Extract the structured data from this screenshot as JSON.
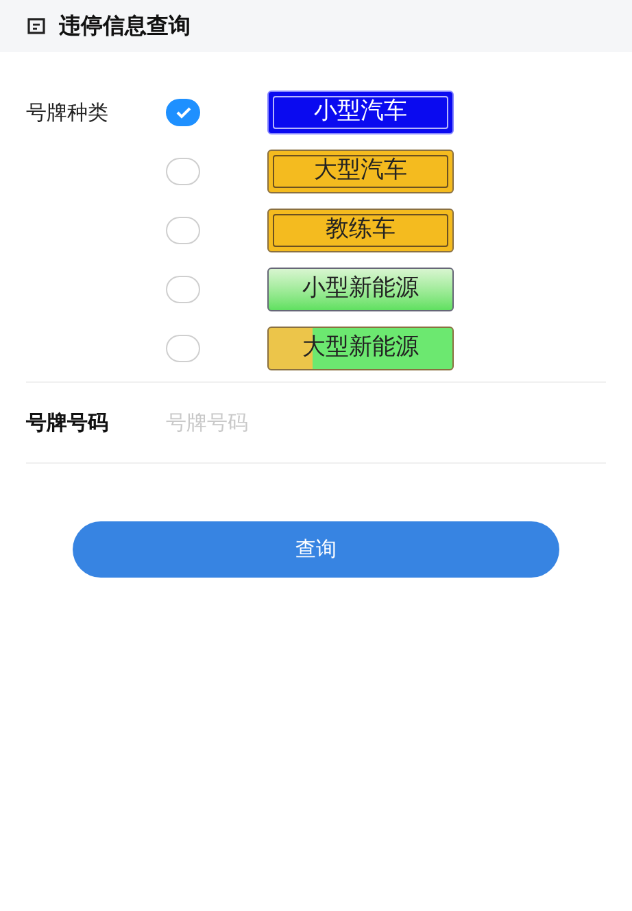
{
  "header": {
    "title": "违停信息查询"
  },
  "plate_type": {
    "label": "号牌种类",
    "options": [
      {
        "text": "小型汽车",
        "kind": "blue",
        "selected": true
      },
      {
        "text": "大型汽车",
        "kind": "yellow",
        "selected": false
      },
      {
        "text": "教练车",
        "kind": "yellow",
        "selected": false
      },
      {
        "text": "小型新能源",
        "kind": "green",
        "selected": false
      },
      {
        "text": "大型新能源",
        "kind": "yellowgreen",
        "selected": false
      }
    ]
  },
  "plate_number": {
    "label": "号牌号码",
    "placeholder": "号牌号码"
  },
  "submit": {
    "label": "查询"
  }
}
